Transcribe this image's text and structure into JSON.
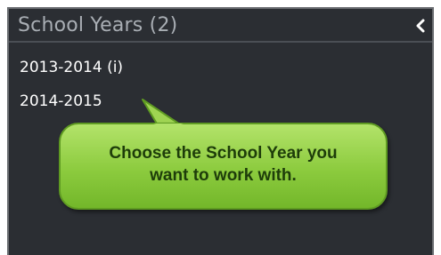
{
  "panel": {
    "title": "School Years (2)",
    "collapse_icon": "chevron-left-icon"
  },
  "school_years": [
    {
      "label": "2013-2014 (i)"
    },
    {
      "label": "2014-2015"
    }
  ],
  "callout": {
    "line1": "Choose the School Year you",
    "line2": "want to work with.",
    "color": "#8ccb3e"
  }
}
